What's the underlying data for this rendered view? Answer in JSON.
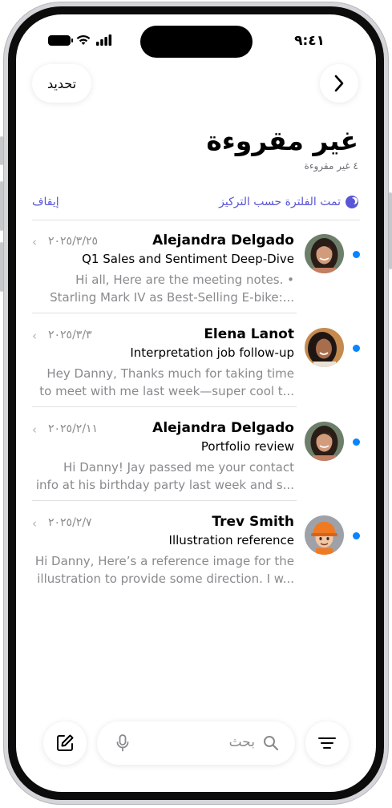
{
  "status_bar": {
    "time": "٩:٤١"
  },
  "header": {
    "back_icon": "chevron-right-icon",
    "edit_label": "تحديد",
    "title": "غير مقروءة",
    "subtitle": "٤ غير مقروءة"
  },
  "filter_bar": {
    "info_text": "تمت الفلترة حسب التركيز",
    "focus_icon": "moon-icon",
    "stop_label": "إيقاف",
    "accent_color": "#5856d6"
  },
  "messages": [
    {
      "sender": "Alejandra Delgado",
      "date": "٢٠٢٥/٣/٢٥",
      "subject": "Q1 Sales and Sentiment Deep-Dive",
      "preview_line1": "Hi all, Here are the meeting notes. •",
      "preview_line2": "Starling Mark IV as Best-Selling E-bike:...",
      "unread": true,
      "avatar": "woman-dark-hair-photo"
    },
    {
      "sender": "Elena Lanot",
      "date": "٢٠٢٥/٣/٣",
      "subject": "Interpretation job follow-up",
      "preview_line1": "Hey Danny, Thanks much for taking time",
      "preview_line2": "to meet with me last week—super cool t...",
      "unread": true,
      "avatar": "woman-smiling-photo"
    },
    {
      "sender": "Alejandra Delgado",
      "date": "٢٠٢٥/٢/١١",
      "subject": "Portfolio review",
      "preview_line1": "Hi Danny! Jay passed me your contact",
      "preview_line2": "info at his birthday party last week and s...",
      "unread": true,
      "avatar": "woman-dark-hair-photo"
    },
    {
      "sender": "Trev Smith",
      "date": "٢٠٢٥/٢/٧",
      "subject": "Illustration reference",
      "preview_line1": "Hi Danny, Here’s a reference image for the",
      "preview_line2": "illustration to provide some direction. I w...",
      "unread": true,
      "avatar": "memoji-orange-hat"
    }
  ],
  "toolbar": {
    "compose_icon": "compose-icon",
    "search_placeholder": "بحث",
    "mic_icon": "microphone-icon",
    "search_icon": "search-icon",
    "filter_icon": "filter-lines-icon"
  },
  "colors": {
    "unread_dot": "#0a84ff",
    "secondary_text": "#8a8a8e"
  }
}
